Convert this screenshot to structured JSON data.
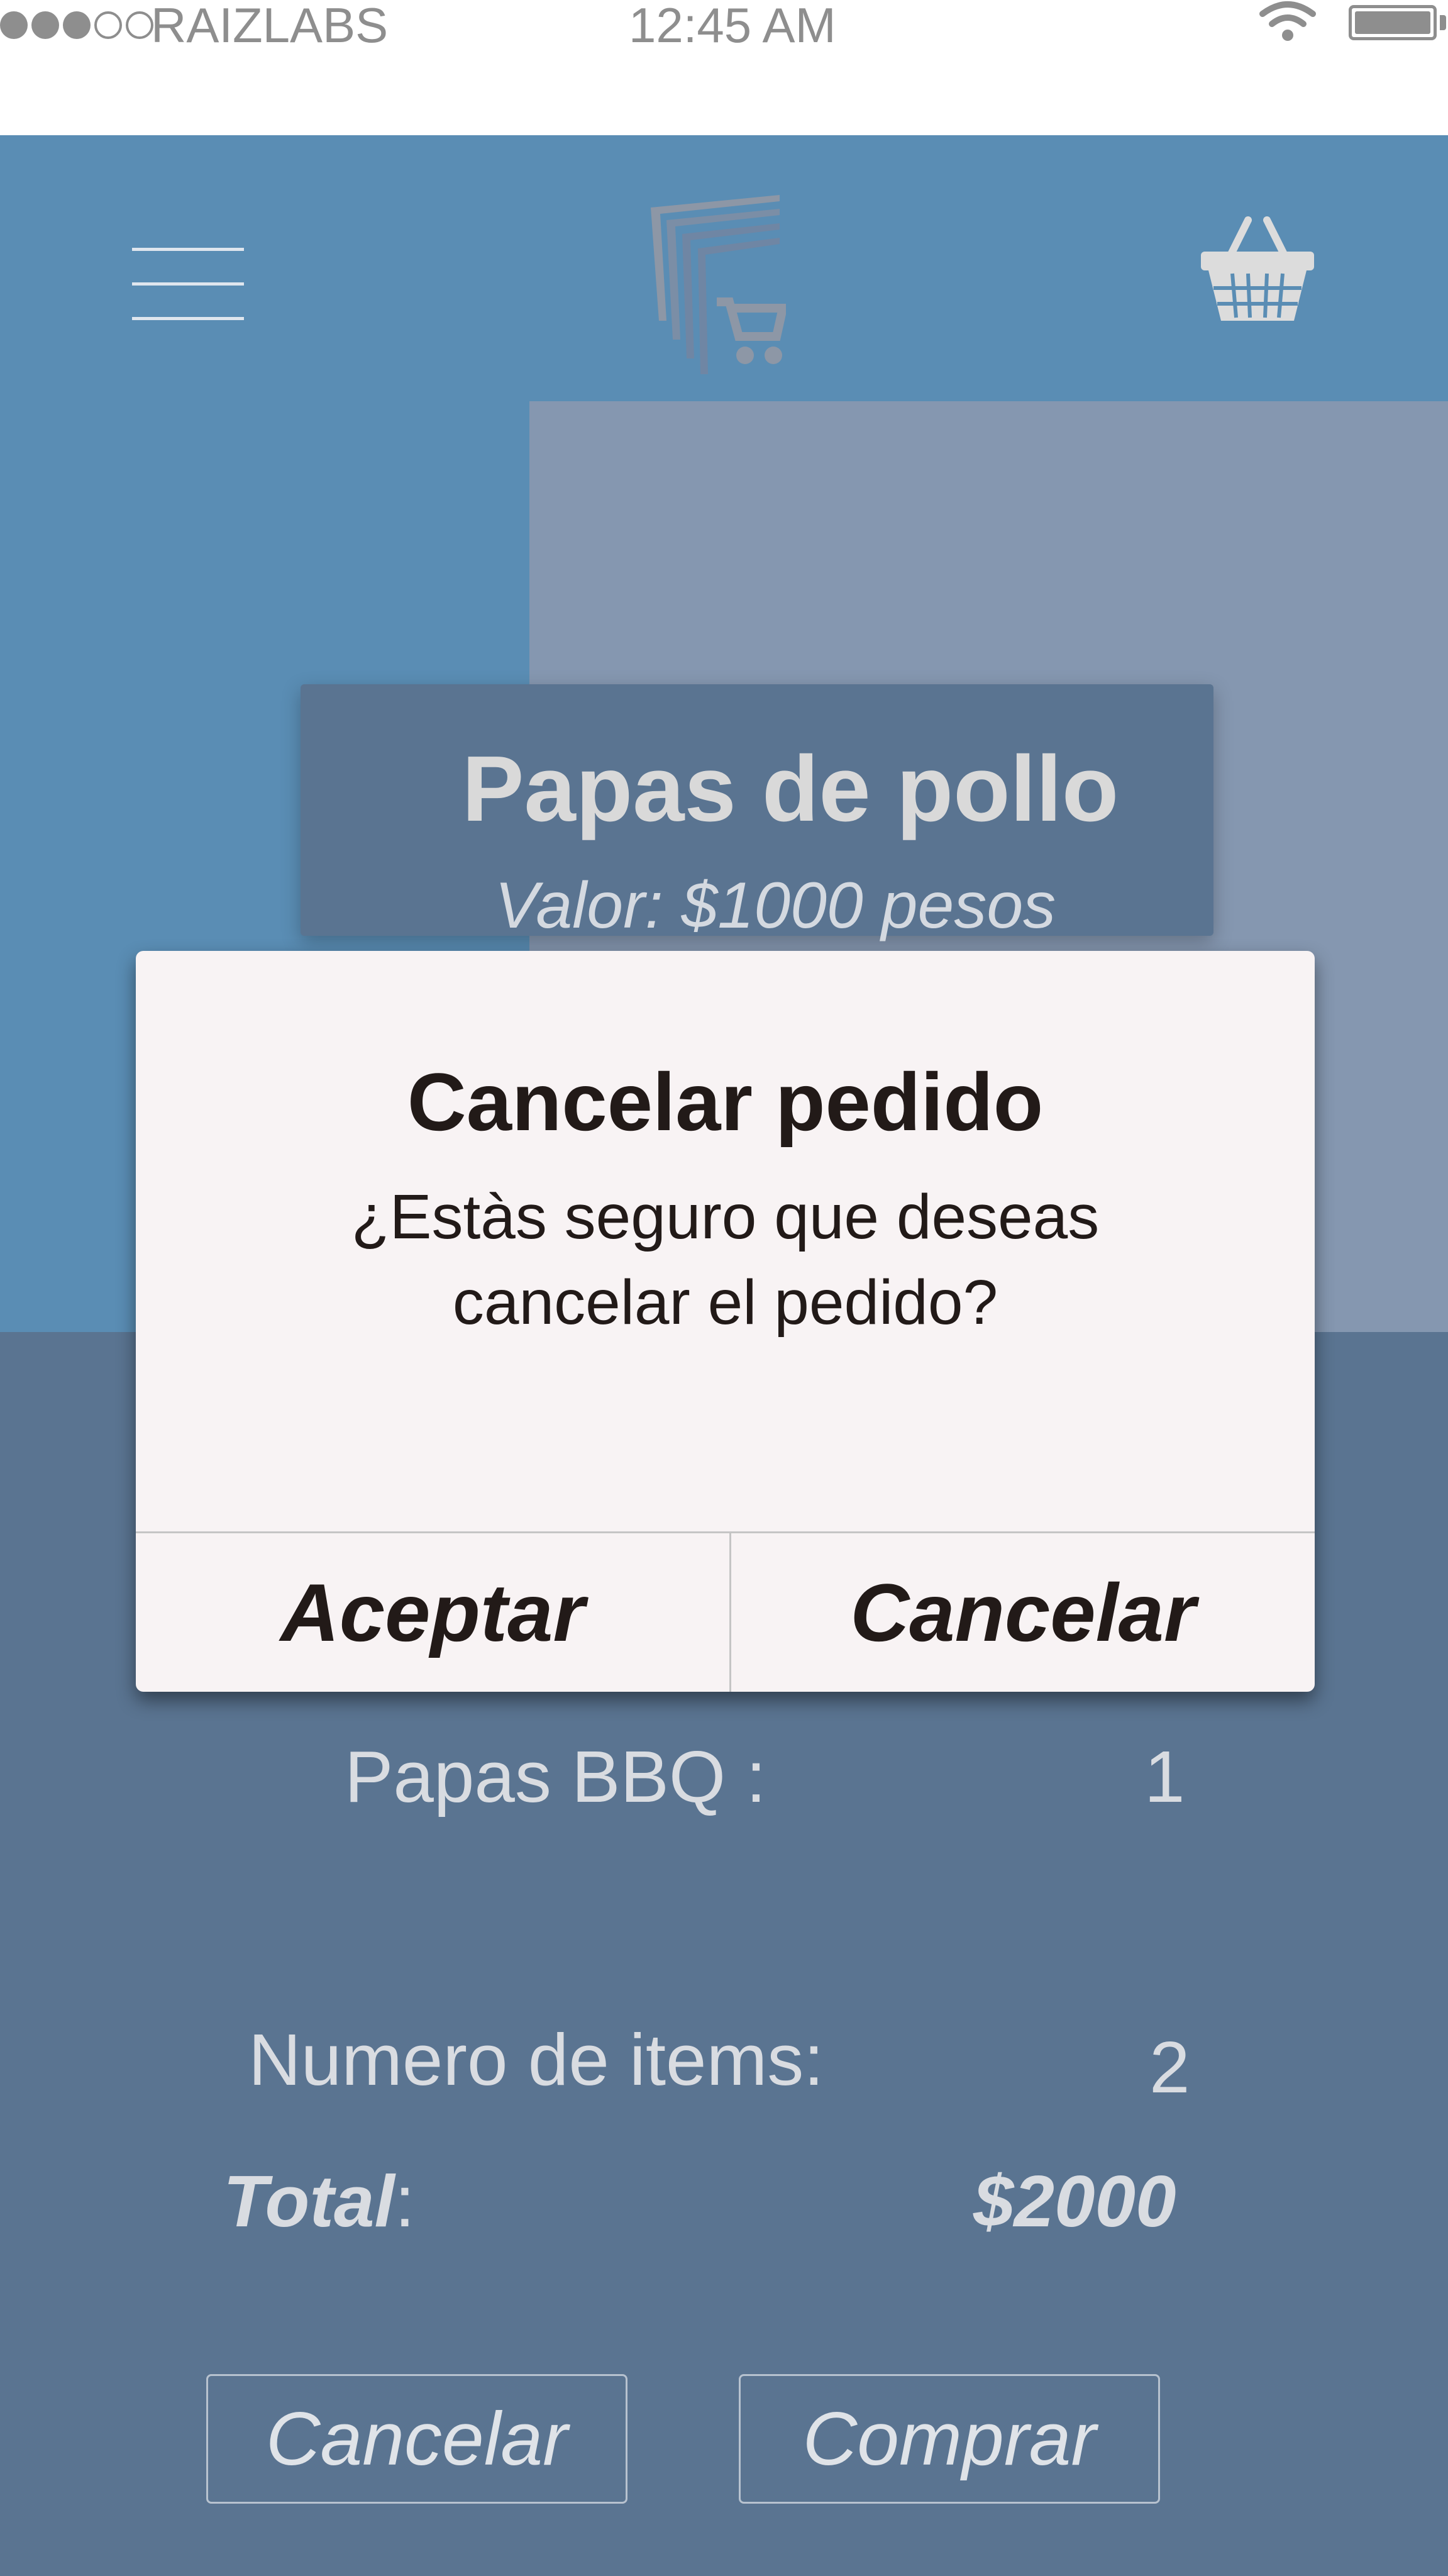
{
  "status_bar": {
    "carrier": "RAIZLABS",
    "time": "12:45 AM",
    "signal_bars_filled": 3,
    "signal_bars_total": 5
  },
  "header": {
    "menu_icon": "hamburger-menu-icon",
    "logo_icon": "store-cart-logo-icon",
    "cart_icon": "shopping-basket-icon"
  },
  "product": {
    "name": "Papas de pollo",
    "price": "Valor: $1000  pesos"
  },
  "summary": {
    "item_name": "Papas BBQ :",
    "item_qty": "1",
    "count_label": "Numero de items:",
    "count_value": "2",
    "total_label": "Total",
    "total_colon": ":",
    "total_value": "$2000"
  },
  "actions": {
    "cancel_label": "Cancelar",
    "buy_label": "Comprar"
  },
  "dialog": {
    "title": "Cancelar pedido",
    "message": "¿Estàs seguro que deseas cancelar el pedido?",
    "accept_label": "Aceptar",
    "cancel_label": "Cancelar"
  },
  "colors": {
    "app_blue": "#5a8db4",
    "panel_slate": "#5a7491",
    "side_panel": "#8597b0",
    "dialog_bg": "#f8f3f4"
  }
}
